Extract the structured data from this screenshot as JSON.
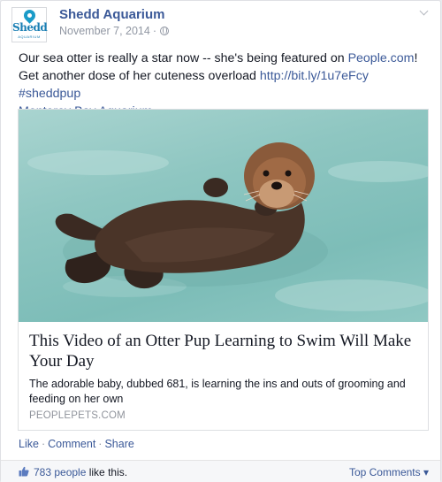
{
  "page": {
    "name": "Shedd Aquarium",
    "date": "November 7, 2014",
    "dot": "·",
    "avatar_word": "Shedd",
    "avatar_sub": "AQUARIUM"
  },
  "message": {
    "line1_text": "Our sea otter is really a star now -- she's being featured on ",
    "line1_link": "People.com",
    "line1_end": "!",
    "line2_text": "Get another dose of her cuteness overload ",
    "url_link": "http://bit.ly/1u7eFcy",
    "hashtag": "#sheddpup",
    "tag_link": "Monterey Bay Aquarium"
  },
  "card": {
    "title": "This Video of an Otter Pup Learning to Swim Will Make Your Day",
    "description": "The adorable baby, dubbed 681, is learning the ins and outs of grooming and feeding on her own",
    "source": "PEOPLEPETS.COM"
  },
  "actions": {
    "like": "Like",
    "comment": "Comment",
    "share": "Share",
    "sep": "·"
  },
  "likes": {
    "count_link": "783 people",
    "suffix": " like this.",
    "top_comments": "Top Comments ▾"
  },
  "colors": {
    "link": "#3b5998",
    "meta": "#9197a3",
    "brand": "#1a9bc8"
  },
  "icons": [
    "globe-icon",
    "chevron-down-icon",
    "thumbs-up-icon"
  ]
}
